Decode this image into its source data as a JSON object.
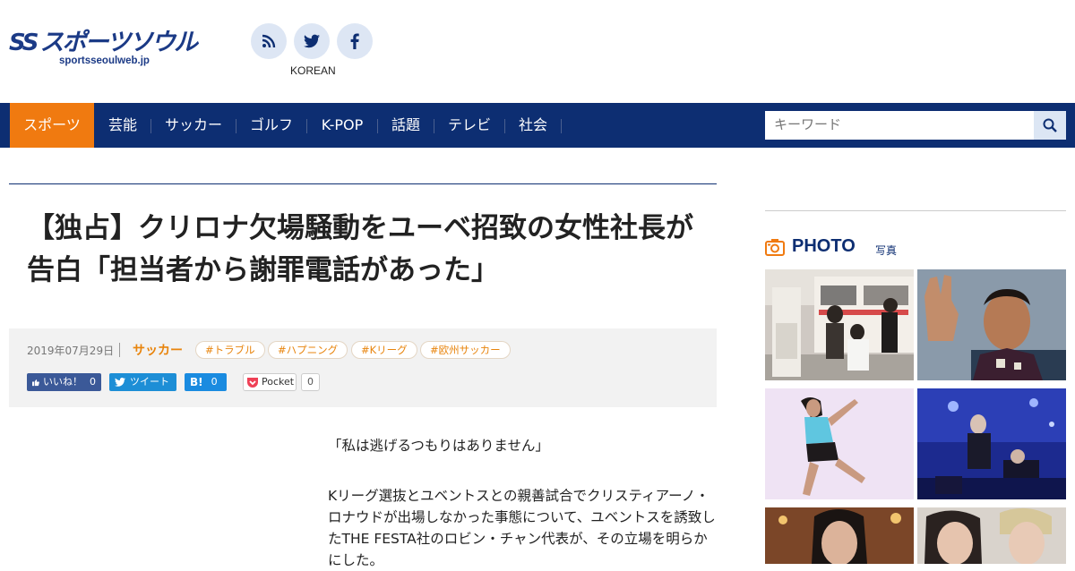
{
  "header": {
    "logo_text": "スポーツソウル",
    "logo_ss": "SS",
    "logo_domain": "sportsseoulweb.jp",
    "social_icons": [
      "rss-icon",
      "twitter-icon",
      "facebook-icon"
    ],
    "language_link": "KOREAN"
  },
  "nav": {
    "items": [
      "スポーツ",
      "芸能",
      "サッカー",
      "ゴルフ",
      "K-POP",
      "話題",
      "テレビ",
      "社会"
    ],
    "active_index": 0,
    "search_placeholder": "キーワード"
  },
  "article": {
    "title": "【独占】クリロナ欠場騒動をユーベ招致の女性社長が告白「担当者から謝罪電話があった」",
    "date": "2019年07月29日",
    "category": "サッカー",
    "tags": [
      "#トラブル",
      "#ハプニング",
      "#Kリーグ",
      "#欧州サッカー"
    ],
    "share": {
      "like_label": "いいね！",
      "like_count": "0",
      "tweet_label": "ツイート",
      "hatena_label": "B!",
      "hatena_count": "0",
      "pocket_label": "Pocket",
      "pocket_count": "0"
    },
    "paragraphs": [
      "「私は逃げるつもりはありません」",
      "Kリーグ選抜とユベントスとの親善試合でクリスティアーノ・ロナウドが出場しなかった事態について、ユベントスを誘致したTHE FESTA社のロビン・チャン代表が、その立場を明らかにした。"
    ]
  },
  "sidebar": {
    "photo_heading": "PHOTO",
    "photo_subheading": "写真"
  },
  "colors": {
    "nav_bg": "#0d2e72",
    "accent": "#f07a10",
    "tag_text": "#e8840c"
  }
}
